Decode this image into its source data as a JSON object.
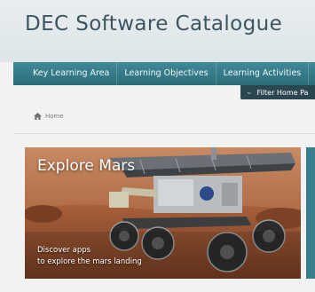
{
  "header": {
    "title": "DEC Software Catalogue"
  },
  "nav": {
    "items": [
      {
        "label": "Key Learning Area"
      },
      {
        "label": "Learning Objectives"
      },
      {
        "label": "Learning Activities"
      }
    ],
    "filter_label": "Filter Home Pa"
  },
  "breadcrumb": {
    "home_label": "Home"
  },
  "feature": {
    "title": "Explore Mars",
    "description_line1": "Discover apps",
    "description_line2": "to explore the mars landing"
  },
  "colors": {
    "nav_bg": "#3a7f8d",
    "filter_bg": "#2a4750",
    "title_text": "#3e5560"
  }
}
